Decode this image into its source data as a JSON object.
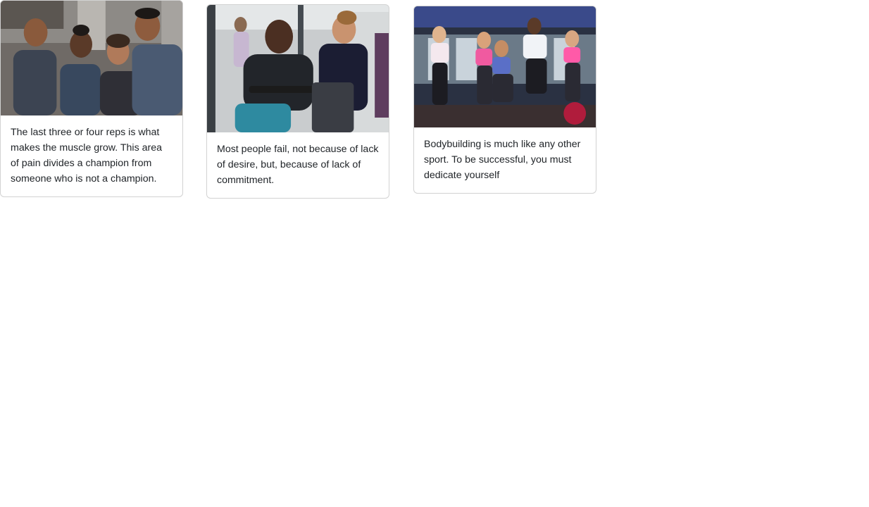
{
  "cards": [
    {
      "image": "group-of-four-smiling-people-in-gym-photo",
      "text": "The last three or four reps is what makes the muscle grow. This area of pain divides a champion from someone who is not a champion."
    },
    {
      "image": "man-on-rowing-machine-with-trainer-photo",
      "text": "Most people fail, not because of lack of desire, but, because of lack of commitment."
    },
    {
      "image": "group-jumping-in-fitness-class-photo",
      "text": "Bodybuilding is much like any other sport. To be successful, you must dedicate yourself"
    }
  ]
}
